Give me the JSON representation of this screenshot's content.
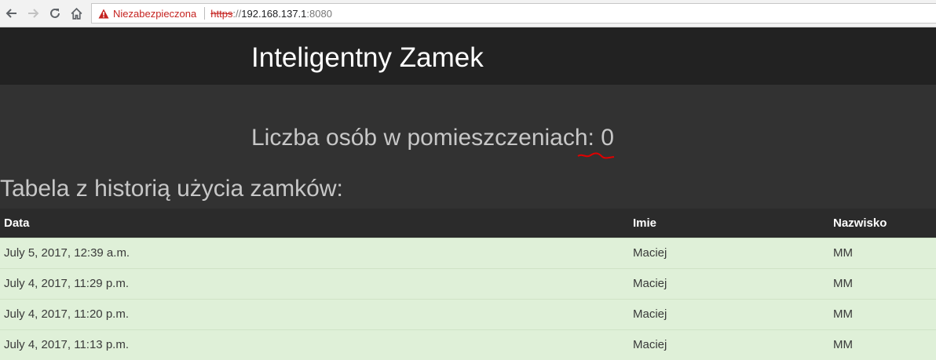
{
  "browser": {
    "security_label": "Niezabezpieczona",
    "url_scheme": "https",
    "url_separator": "://",
    "url_host": "192.168.137.1",
    "url_port": ":8080"
  },
  "page": {
    "title": "Inteligentny Zamek",
    "count_label": "Liczba osób w pomieszczeniach:",
    "count_value": "0",
    "table_heading": "Tabela z historią użycia zamków:"
  },
  "table": {
    "columns": [
      "Data",
      "Imie",
      "Nazwisko"
    ],
    "rows": [
      [
        "July 5, 2017, 12:39 a.m.",
        "Maciej",
        "MM"
      ],
      [
        "July 4, 2017, 11:29 p.m.",
        "Maciej",
        "MM"
      ],
      [
        "July 4, 2017, 11:20 p.m.",
        "Maciej",
        "MM"
      ],
      [
        "July 4, 2017, 11:13 p.m.",
        "Maciej",
        "MM"
      ]
    ]
  },
  "colors": {
    "header_bg": "#222222",
    "page_bg": "#323232",
    "row_bg": "#dff0d8",
    "warning_red": "#c5221f",
    "annotation_red": "#e00000"
  },
  "icons": [
    "back-arrow-icon",
    "forward-arrow-icon",
    "reload-icon",
    "home-icon",
    "warning-triangle-icon"
  ]
}
